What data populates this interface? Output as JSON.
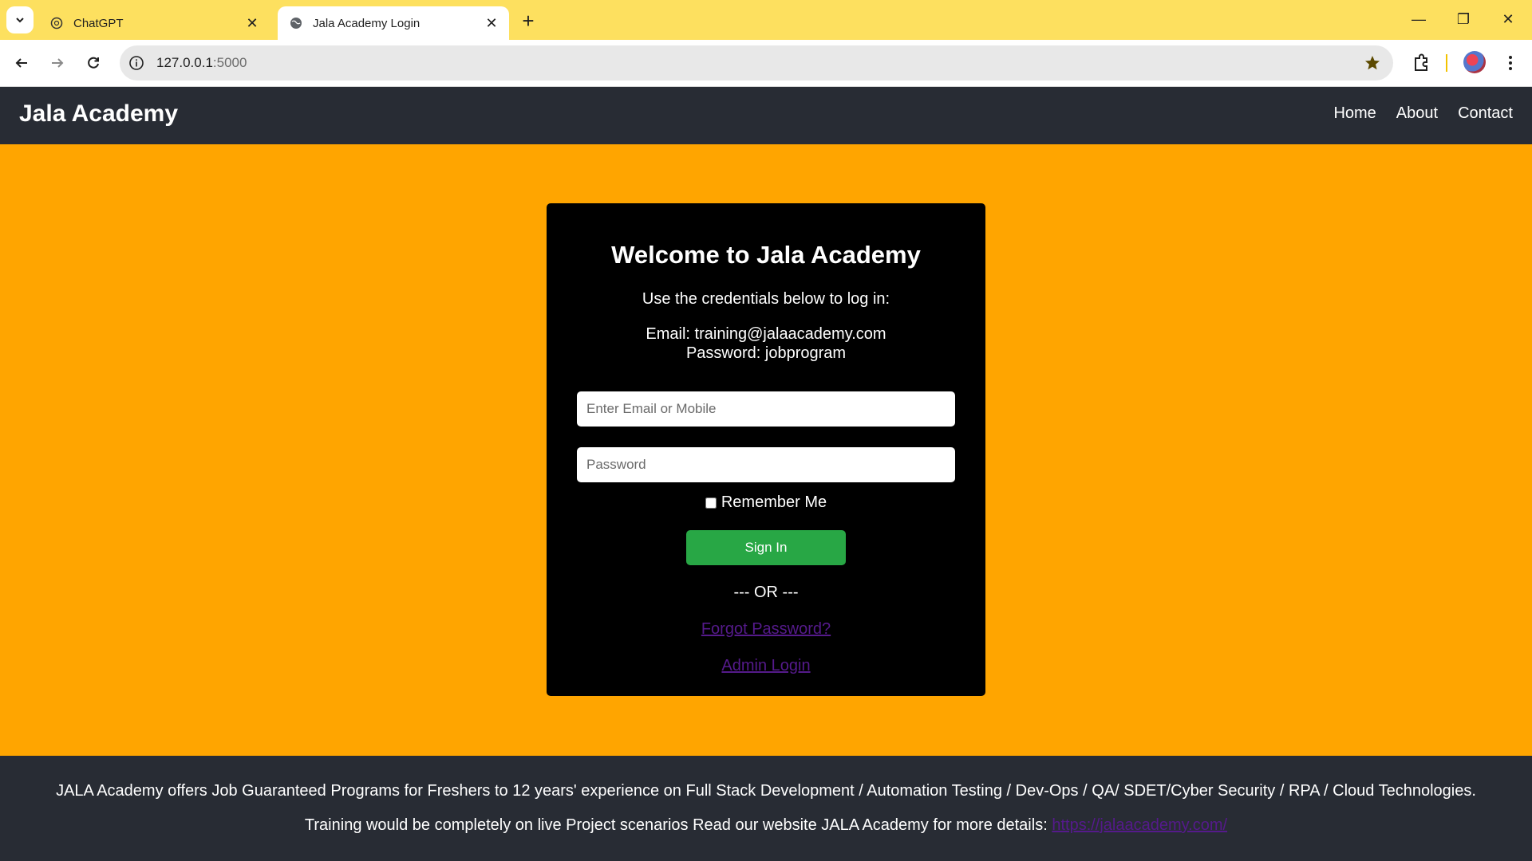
{
  "browser": {
    "tabs": [
      {
        "title": "ChatGPT",
        "favicon": "openai-icon",
        "active": false
      },
      {
        "title": "Jala Academy Login",
        "favicon": "globe-icon",
        "active": true
      }
    ],
    "url_host": "127.0.0.1",
    "url_port": ":5000"
  },
  "site": {
    "brand": "Jala Academy",
    "nav": [
      "Home",
      "About",
      "Contact"
    ]
  },
  "login": {
    "heading": "Welcome to Jala Academy",
    "intro": "Use the credentials below to log in:",
    "email_line": "Email: training@jalaacademy.com",
    "password_line": "Password: jobprogram",
    "email_placeholder": "Enter Email or Mobile",
    "password_placeholder": "Password",
    "remember_label": "Remember Me",
    "signin_label": "Sign In",
    "or_text": "--- OR ---",
    "forgot_label": "Forgot Password?",
    "admin_label": "Admin Login"
  },
  "footer": {
    "line1": "JALA Academy offers Job Guaranteed Programs for Freshers to 12 years' experience on Full Stack Development / Automation Testing / Dev-Ops / QA/ SDET/Cyber Security / RPA / Cloud Technologies.",
    "line2": "Training would be completely on live Project scenarios Read our website JALA Academy for more details:",
    "link": "https://jalaacademy.com/"
  },
  "colors": {
    "page_bg": "#ffa500",
    "header_bg": "#282c34",
    "card_bg": "#000000",
    "signin_bg": "#28a745",
    "link": "#551a8b",
    "tabbar_bg": "#fde05f"
  }
}
